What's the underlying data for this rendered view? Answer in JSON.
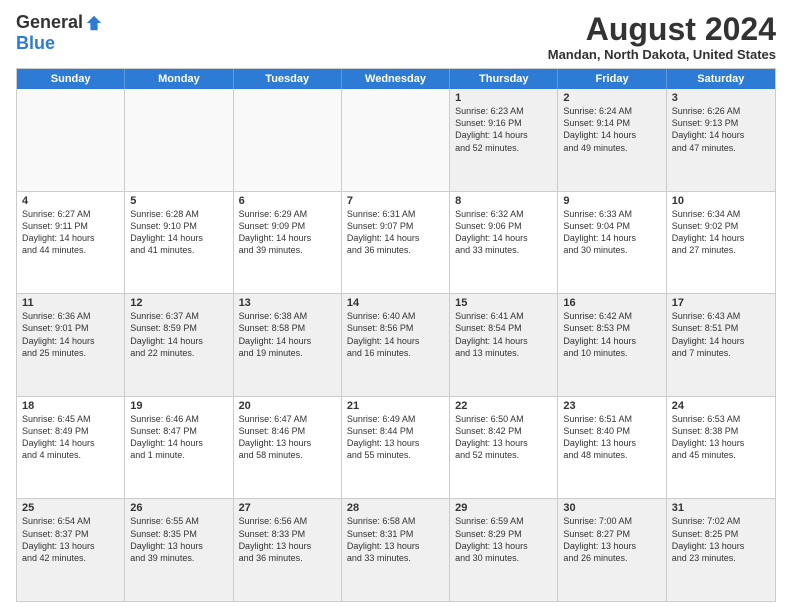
{
  "logo": {
    "general": "General",
    "blue": "Blue"
  },
  "title": "August 2024",
  "location": "Mandan, North Dakota, United States",
  "days": [
    "Sunday",
    "Monday",
    "Tuesday",
    "Wednesday",
    "Thursday",
    "Friday",
    "Saturday"
  ],
  "weeks": [
    [
      {
        "day": "",
        "text": ""
      },
      {
        "day": "",
        "text": ""
      },
      {
        "day": "",
        "text": ""
      },
      {
        "day": "",
        "text": ""
      },
      {
        "day": "1",
        "text": "Sunrise: 6:23 AM\nSunset: 9:16 PM\nDaylight: 14 hours\nand 52 minutes."
      },
      {
        "day": "2",
        "text": "Sunrise: 6:24 AM\nSunset: 9:14 PM\nDaylight: 14 hours\nand 49 minutes."
      },
      {
        "day": "3",
        "text": "Sunrise: 6:26 AM\nSunset: 9:13 PM\nDaylight: 14 hours\nand 47 minutes."
      }
    ],
    [
      {
        "day": "4",
        "text": "Sunrise: 6:27 AM\nSunset: 9:11 PM\nDaylight: 14 hours\nand 44 minutes."
      },
      {
        "day": "5",
        "text": "Sunrise: 6:28 AM\nSunset: 9:10 PM\nDaylight: 14 hours\nand 41 minutes."
      },
      {
        "day": "6",
        "text": "Sunrise: 6:29 AM\nSunset: 9:09 PM\nDaylight: 14 hours\nand 39 minutes."
      },
      {
        "day": "7",
        "text": "Sunrise: 6:31 AM\nSunset: 9:07 PM\nDaylight: 14 hours\nand 36 minutes."
      },
      {
        "day": "8",
        "text": "Sunrise: 6:32 AM\nSunset: 9:06 PM\nDaylight: 14 hours\nand 33 minutes."
      },
      {
        "day": "9",
        "text": "Sunrise: 6:33 AM\nSunset: 9:04 PM\nDaylight: 14 hours\nand 30 minutes."
      },
      {
        "day": "10",
        "text": "Sunrise: 6:34 AM\nSunset: 9:02 PM\nDaylight: 14 hours\nand 27 minutes."
      }
    ],
    [
      {
        "day": "11",
        "text": "Sunrise: 6:36 AM\nSunset: 9:01 PM\nDaylight: 14 hours\nand 25 minutes."
      },
      {
        "day": "12",
        "text": "Sunrise: 6:37 AM\nSunset: 8:59 PM\nDaylight: 14 hours\nand 22 minutes."
      },
      {
        "day": "13",
        "text": "Sunrise: 6:38 AM\nSunset: 8:58 PM\nDaylight: 14 hours\nand 19 minutes."
      },
      {
        "day": "14",
        "text": "Sunrise: 6:40 AM\nSunset: 8:56 PM\nDaylight: 14 hours\nand 16 minutes."
      },
      {
        "day": "15",
        "text": "Sunrise: 6:41 AM\nSunset: 8:54 PM\nDaylight: 14 hours\nand 13 minutes."
      },
      {
        "day": "16",
        "text": "Sunrise: 6:42 AM\nSunset: 8:53 PM\nDaylight: 14 hours\nand 10 minutes."
      },
      {
        "day": "17",
        "text": "Sunrise: 6:43 AM\nSunset: 8:51 PM\nDaylight: 14 hours\nand 7 minutes."
      }
    ],
    [
      {
        "day": "18",
        "text": "Sunrise: 6:45 AM\nSunset: 8:49 PM\nDaylight: 14 hours\nand 4 minutes."
      },
      {
        "day": "19",
        "text": "Sunrise: 6:46 AM\nSunset: 8:47 PM\nDaylight: 14 hours\nand 1 minute."
      },
      {
        "day": "20",
        "text": "Sunrise: 6:47 AM\nSunset: 8:46 PM\nDaylight: 13 hours\nand 58 minutes."
      },
      {
        "day": "21",
        "text": "Sunrise: 6:49 AM\nSunset: 8:44 PM\nDaylight: 13 hours\nand 55 minutes."
      },
      {
        "day": "22",
        "text": "Sunrise: 6:50 AM\nSunset: 8:42 PM\nDaylight: 13 hours\nand 52 minutes."
      },
      {
        "day": "23",
        "text": "Sunrise: 6:51 AM\nSunset: 8:40 PM\nDaylight: 13 hours\nand 48 minutes."
      },
      {
        "day": "24",
        "text": "Sunrise: 6:53 AM\nSunset: 8:38 PM\nDaylight: 13 hours\nand 45 minutes."
      }
    ],
    [
      {
        "day": "25",
        "text": "Sunrise: 6:54 AM\nSunset: 8:37 PM\nDaylight: 13 hours\nand 42 minutes."
      },
      {
        "day": "26",
        "text": "Sunrise: 6:55 AM\nSunset: 8:35 PM\nDaylight: 13 hours\nand 39 minutes."
      },
      {
        "day": "27",
        "text": "Sunrise: 6:56 AM\nSunset: 8:33 PM\nDaylight: 13 hours\nand 36 minutes."
      },
      {
        "day": "28",
        "text": "Sunrise: 6:58 AM\nSunset: 8:31 PM\nDaylight: 13 hours\nand 33 minutes."
      },
      {
        "day": "29",
        "text": "Sunrise: 6:59 AM\nSunset: 8:29 PM\nDaylight: 13 hours\nand 30 minutes."
      },
      {
        "day": "30",
        "text": "Sunrise: 7:00 AM\nSunset: 8:27 PM\nDaylight: 13 hours\nand 26 minutes."
      },
      {
        "day": "31",
        "text": "Sunrise: 7:02 AM\nSunset: 8:25 PM\nDaylight: 13 hours\nand 23 minutes."
      }
    ]
  ]
}
